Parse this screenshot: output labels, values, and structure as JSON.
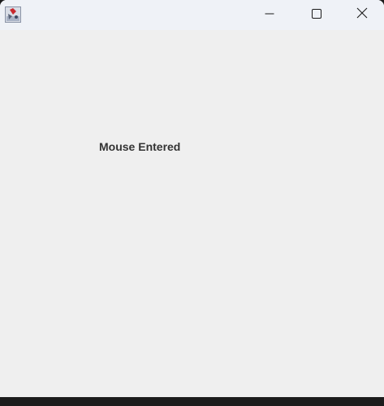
{
  "window": {
    "title": "",
    "controls": {
      "minimize_icon": "minimize-icon",
      "maximize_icon": "maximize-icon",
      "close_icon": "close-icon"
    }
  },
  "content": {
    "status_text": "Mouse Entered"
  },
  "colors": {
    "titlebar": "#eff2f7",
    "content_background": "#efefef",
    "label_text": "#333333",
    "desktop_edge": "#1c1c1c"
  }
}
